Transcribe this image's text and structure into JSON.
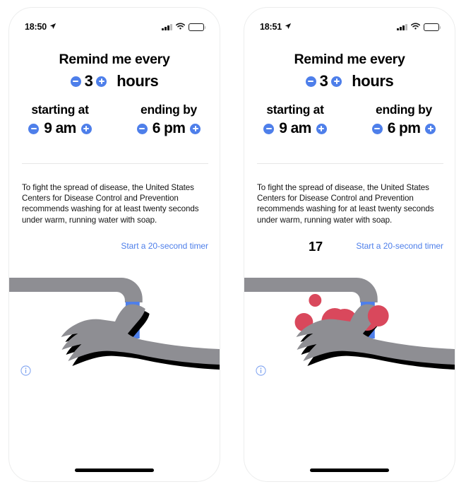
{
  "app": {
    "faucet_color": "#8e8e93",
    "water_color": "#4e7fea",
    "accent_color": "#4e7fea",
    "germ_color": "#d9485c",
    "shadow_color": "#000000"
  },
  "phones": [
    {
      "id": "phone-left",
      "status_bar": {
        "time": "18:50",
        "location_icon": "location-arrow-icon",
        "cellular_icon": "cellular-bars-icon",
        "wifi_icon": "wifi-icon",
        "battery_icon": "battery-icon"
      },
      "settings": {
        "title": "Remind me every",
        "interval_value": "3",
        "interval_unit": "hours",
        "decrement_icon": "minus-circle-icon",
        "increment_icon": "plus-circle-icon",
        "start": {
          "label": "starting at",
          "value": "9 am"
        },
        "end": {
          "label": "ending by",
          "value": "6 pm"
        }
      },
      "body_copy": "To fight the spread of disease, the United States Centers for Disease Control and Prevention recommends washing for at least twenty seconds under warm, running water with soap.",
      "timer": {
        "count": "",
        "link_label": "Start a 20-second timer",
        "running": false
      },
      "illustration": {
        "name": "hand-under-faucet",
        "germs_visible": false,
        "info_icon": "info-circle-icon"
      },
      "home_indicator": true
    },
    {
      "id": "phone-right",
      "status_bar": {
        "time": "18:51",
        "location_icon": "location-arrow-icon",
        "cellular_icon": "cellular-bars-icon",
        "wifi_icon": "wifi-icon",
        "battery_icon": "battery-icon"
      },
      "settings": {
        "title": "Remind me every",
        "interval_value": "3",
        "interval_unit": "hours",
        "decrement_icon": "minus-circle-icon",
        "increment_icon": "plus-circle-icon",
        "start": {
          "label": "starting at",
          "value": "9 am"
        },
        "end": {
          "label": "ending by",
          "value": "6 pm"
        }
      },
      "body_copy": "To fight the spread of disease, the United States Centers for Disease Control and Prevention recommends washing for at least twenty seconds under warm, running water with soap.",
      "timer": {
        "count": "17",
        "link_label": "Start a 20-second timer",
        "running": true
      },
      "illustration": {
        "name": "hand-under-faucet",
        "germs_visible": true,
        "info_icon": "info-circle-icon"
      },
      "home_indicator": true
    }
  ]
}
